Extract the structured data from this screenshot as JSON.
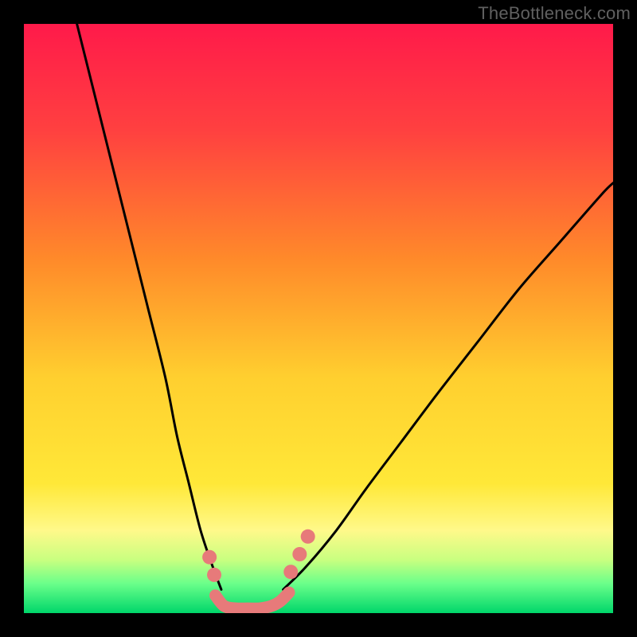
{
  "watermark": "TheBottleneck.com",
  "chart_data": {
    "type": "line",
    "title": "",
    "xlabel": "",
    "ylabel": "",
    "xlim": [
      0,
      100
    ],
    "ylim": [
      0,
      100
    ],
    "grid": false,
    "legend": false,
    "background_gradient": {
      "top_color": "#ff1a4a",
      "mid_color": "#ffe23a",
      "bottom_near": "#52ff7a",
      "bottom_color": "#00d66a"
    },
    "series": [
      {
        "name": "left-branch",
        "x": [
          9,
          12,
          15,
          18,
          21,
          24,
          26,
          28,
          30,
          32,
          33.5
        ],
        "y": [
          100,
          88,
          76,
          64,
          52,
          40,
          30,
          22,
          14,
          8,
          4
        ],
        "style": "solid-black"
      },
      {
        "name": "right-branch",
        "x": [
          44,
          48,
          53,
          58,
          64,
          70,
          77,
          84,
          91,
          98,
          100
        ],
        "y": [
          4,
          8,
          14,
          21,
          29,
          37,
          46,
          55,
          63,
          71,
          73
        ],
        "style": "solid-black"
      },
      {
        "name": "valley-floor",
        "x": [
          32.5,
          34,
          36,
          38,
          40,
          42,
          43.5,
          45
        ],
        "y": [
          3,
          1.2,
          0.8,
          0.8,
          0.8,
          1.2,
          2,
          3.5
        ],
        "style": "pink-dotted"
      }
    ],
    "dot_markers": [
      {
        "x": 31.5,
        "y": 9.5,
        "color": "#e77a7a"
      },
      {
        "x": 32.3,
        "y": 6.5,
        "color": "#e77a7a"
      },
      {
        "x": 45.3,
        "y": 7.0,
        "color": "#e77a7a"
      },
      {
        "x": 46.8,
        "y": 10.0,
        "color": "#e77a7a"
      },
      {
        "x": 48.2,
        "y": 13.0,
        "color": "#e77a7a"
      }
    ]
  }
}
